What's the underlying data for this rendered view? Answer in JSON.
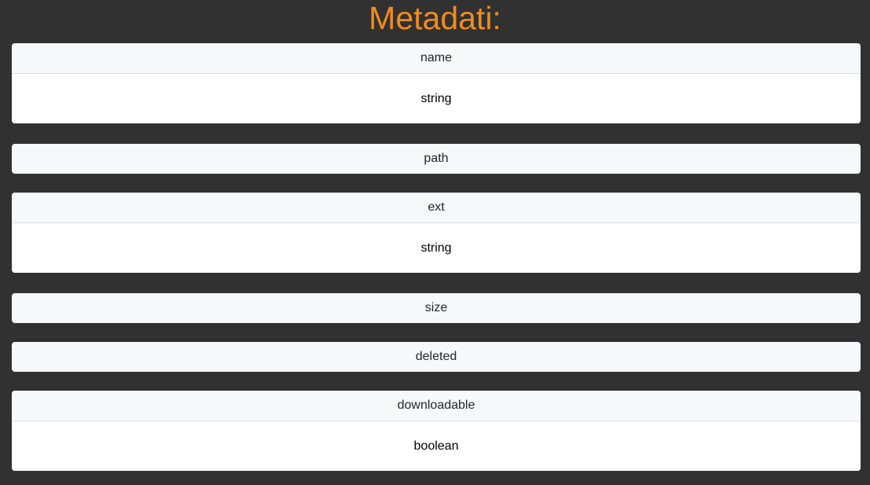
{
  "page": {
    "title": "Metadati:"
  },
  "fields": [
    {
      "name": "name",
      "type": "string"
    },
    {
      "name": "path",
      "type": ""
    },
    {
      "name": "ext",
      "type": "string"
    },
    {
      "name": "size",
      "type": ""
    },
    {
      "name": "deleted",
      "type": ""
    },
    {
      "name": "downloadable",
      "type": "boolean"
    }
  ],
  "colors": {
    "background": "#313131",
    "title": "#f28c1a",
    "card_header": "#f7f8fa",
    "card_body": "#ffffff"
  }
}
